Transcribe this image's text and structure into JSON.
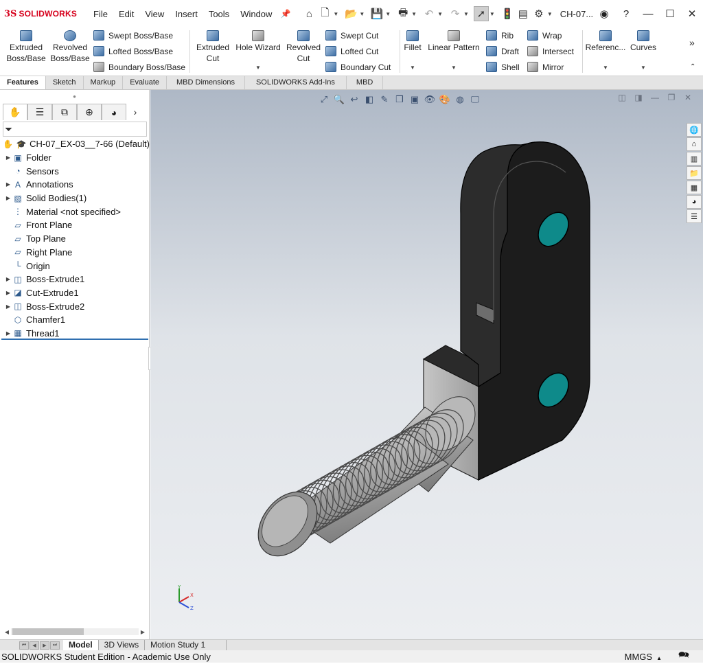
{
  "app": {
    "logo_text": "SOLIDWORKS",
    "logo_ds": "3S",
    "document_title": "CH-07..."
  },
  "menu": [
    "File",
    "Edit",
    "View",
    "Insert",
    "Tools",
    "Window"
  ],
  "ribbon": {
    "extruded_boss": [
      "Extruded",
      "Boss/Base"
    ],
    "revolved_boss": [
      "Revolved",
      "Boss/Base"
    ],
    "swept_boss": "Swept Boss/Base",
    "lofted_boss": "Lofted Boss/Base",
    "boundary_boss": "Boundary Boss/Base",
    "extruded_cut": [
      "Extruded",
      "Cut"
    ],
    "hole_wizard": "Hole Wizard",
    "revolved_cut": [
      "Revolved",
      "Cut"
    ],
    "swept_cut": "Swept Cut",
    "lofted_cut": "Lofted Cut",
    "boundary_cut": "Boundary Cut",
    "fillet": "Fillet",
    "linear_pattern": "Linear Pattern",
    "rib": "Rib",
    "draft": "Draft",
    "shell": "Shell",
    "wrap": "Wrap",
    "intersect": "Intersect",
    "mirror": "Mirror",
    "reference": "Referenc...",
    "curves": "Curves"
  },
  "command_tabs": [
    "Features",
    "Sketch",
    "Markup",
    "Evaluate",
    "MBD Dimensions",
    "SOLIDWORKS Add-Ins",
    "MBD"
  ],
  "tree": {
    "root": "CH-07_EX-03__7-66  (Default)",
    "items": [
      {
        "label": "Folder",
        "expandable": true,
        "icon": "folder-icon"
      },
      {
        "label": "Sensors",
        "expandable": false,
        "icon": "sensor-icon"
      },
      {
        "label": "Annotations",
        "expandable": true,
        "icon": "annotation-icon"
      },
      {
        "label": "Solid Bodies(1)",
        "expandable": true,
        "icon": "solid-bodies-icon"
      },
      {
        "label": "Material <not specified>",
        "expandable": false,
        "icon": "material-icon"
      },
      {
        "label": "Front Plane",
        "expandable": false,
        "icon": "plane-icon"
      },
      {
        "label": "Top Plane",
        "expandable": false,
        "icon": "plane-icon"
      },
      {
        "label": "Right Plane",
        "expandable": false,
        "icon": "plane-icon"
      },
      {
        "label": "Origin",
        "expandable": false,
        "icon": "origin-icon"
      },
      {
        "label": "Boss-Extrude1",
        "expandable": true,
        "icon": "extrude-icon"
      },
      {
        "label": "Cut-Extrude1",
        "expandable": true,
        "icon": "cut-extrude-icon"
      },
      {
        "label": "Boss-Extrude2",
        "expandable": true,
        "icon": "extrude-icon"
      },
      {
        "label": "Chamfer1",
        "expandable": false,
        "icon": "chamfer-icon"
      },
      {
        "label": "Thread1",
        "expandable": true,
        "icon": "thread-icon"
      }
    ]
  },
  "bottom_tabs": [
    "Model",
    "3D Views",
    "Motion Study 1"
  ],
  "status": {
    "edition": "SOLIDWORKS Student Edition - Academic Use Only",
    "units": "MMGS"
  },
  "colors": {
    "accent": "#d6001c",
    "part_body": "#1e1e1e",
    "hole_teal": "#0e8a8a",
    "thread_gray": "#9a9a9a"
  }
}
